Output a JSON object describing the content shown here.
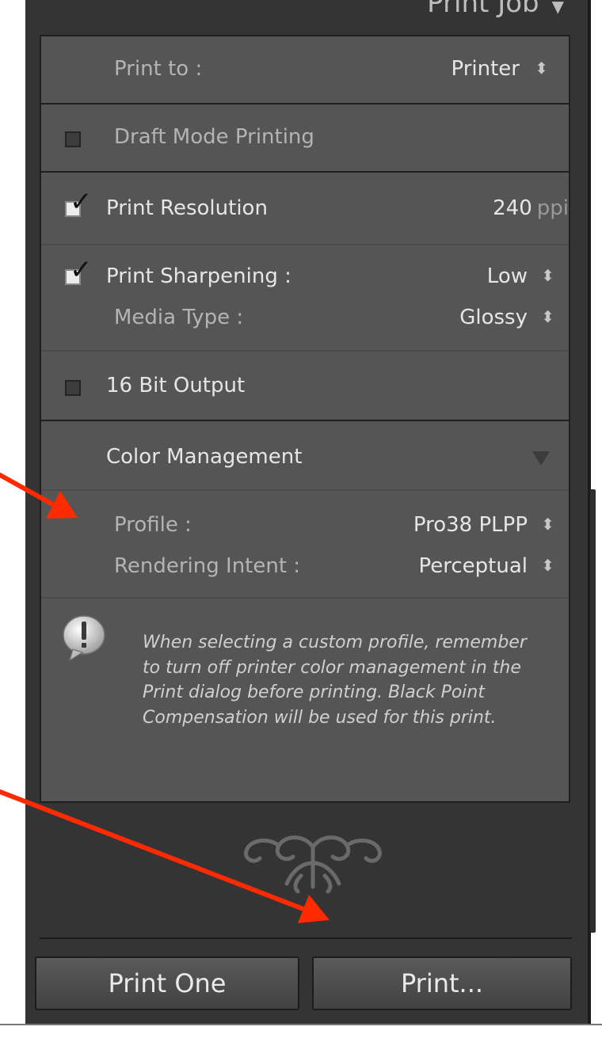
{
  "panel": {
    "title": "Print Job"
  },
  "print_to": {
    "label": "Print to :",
    "value": "Printer"
  },
  "draft_mode": {
    "label": "Draft Mode Printing",
    "checked": false
  },
  "resolution": {
    "label": "Print Resolution",
    "checked": true,
    "value": "240",
    "unit": "ppi"
  },
  "sharpening": {
    "label": "Print Sharpening :",
    "checked": true,
    "value": "Low"
  },
  "media_type": {
    "label": "Media Type :",
    "value": "Glossy"
  },
  "bit16": {
    "label": "16 Bit Output",
    "checked": false
  },
  "color_management": {
    "title": "Color Management",
    "profile_label": "Profile :",
    "profile_value": "Pro38 PLPP",
    "intent_label": "Rendering Intent :",
    "intent_value": "Perceptual",
    "note": "When selecting a custom profile, remember to turn off printer color management in the Print dialog before printing. Black Point Compensation will be used for this print."
  },
  "buttons": {
    "print_one": "Print One",
    "print": "Print..."
  },
  "icons": {
    "stepper": "up-down-stepper-icon",
    "collapse": "collapse-triangle-icon",
    "warning": "warning-speech-bubble-icon",
    "ornament": "panel-end-ornament-icon"
  },
  "colors": {
    "panel_bg": "#343434",
    "group_bg": "#555555",
    "annotation_arrow": "#ff2a00"
  }
}
